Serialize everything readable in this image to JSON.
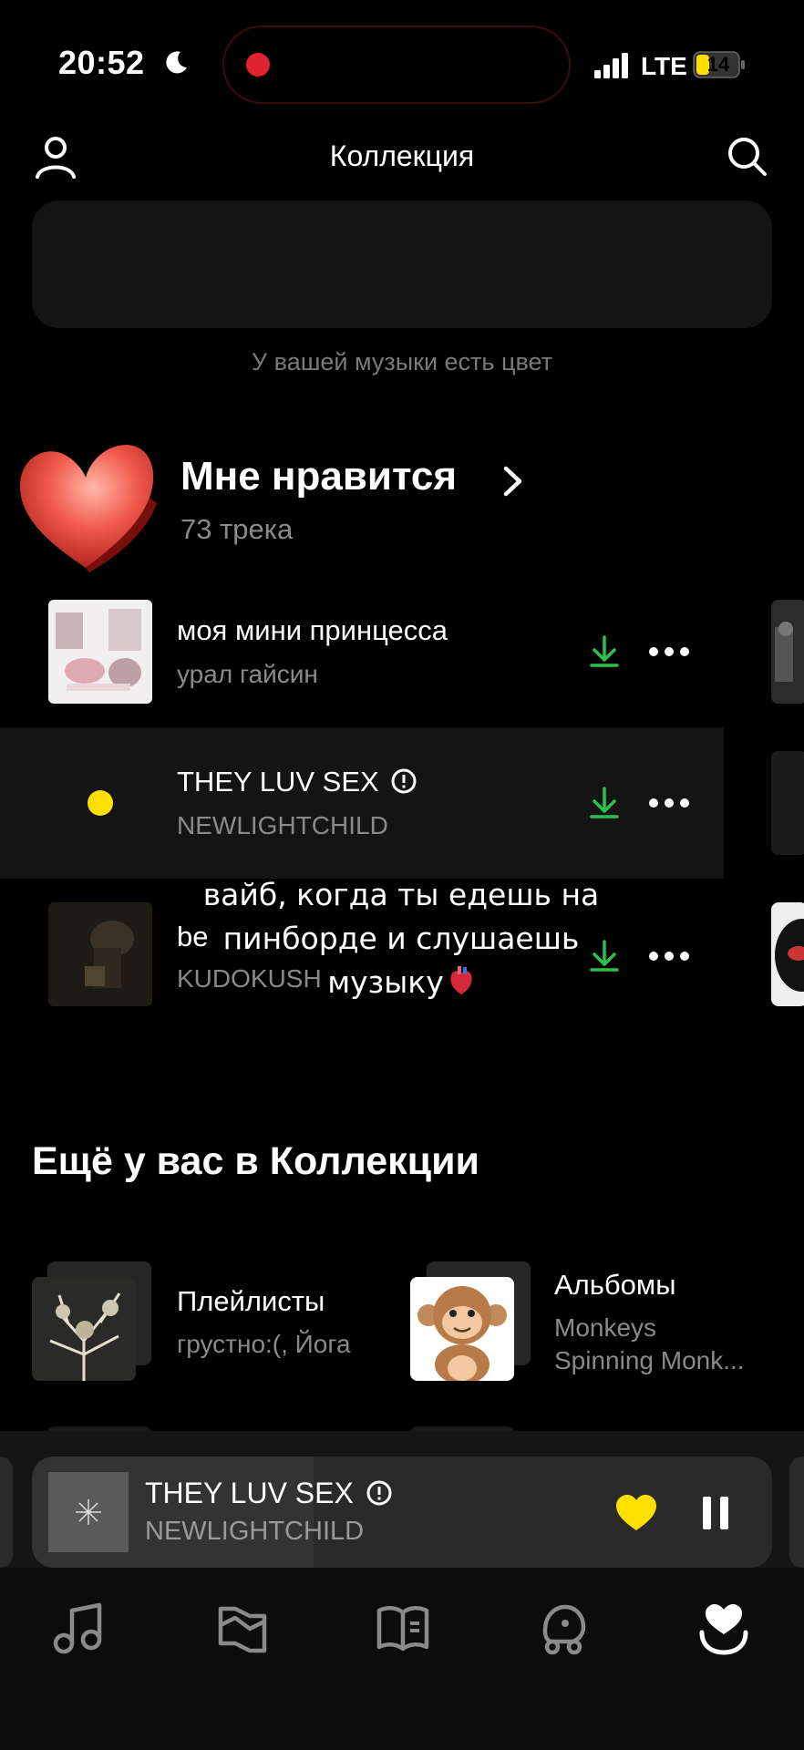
{
  "status_bar": {
    "time": "20:52",
    "network": "LTE",
    "battery": "14",
    "icons": [
      "moon-icon",
      "signal-icon",
      "battery-icon",
      "recording-dot"
    ]
  },
  "header": {
    "title": "Коллекция",
    "left_icon": "profile-icon",
    "right_icon": "search-icon"
  },
  "banner": {
    "caption": "У вашей музыки есть цвет"
  },
  "likes": {
    "title": "Мне нравится",
    "count": "73 трека"
  },
  "tracks": [
    {
      "title": "моя мини принцесса",
      "artist": "урал гайсин",
      "downloaded": true
    },
    {
      "title": "THEY LUV SEX",
      "artist": "NEWLIGHTCHILD",
      "explicit": true,
      "playing": true,
      "downloaded": true
    },
    {
      "title": "be",
      "artist": "KUDOKUSH",
      "downloaded": true
    }
  ],
  "overlay_caption": {
    "line1": "вайб, когда ты едешь на",
    "line2": "пинборде и слушаешь",
    "line3": "музыку"
  },
  "collection": {
    "title": "Ещё у вас в Коллекции",
    "items": [
      {
        "title": "Плейлисты",
        "subtitle": "грустно:(, Йога"
      },
      {
        "title": "Альбомы",
        "subtitle_line1": "Monkeys",
        "subtitle_line2": "Spinning Monk..."
      }
    ]
  },
  "player": {
    "title": "THEY LUV SEX",
    "artist": "NEWLIGHTCHILD",
    "explicit": true,
    "liked": true,
    "state": "playing",
    "progress_fraction": 0.38
  },
  "nav": {
    "items": [
      {
        "id": "music",
        "icon": "music-note-icon"
      },
      {
        "id": "podcasts",
        "icon": "map-icon"
      },
      {
        "id": "books",
        "icon": "book-icon"
      },
      {
        "id": "kids",
        "icon": "kids-icon"
      },
      {
        "id": "collection",
        "icon": "heart-collection-icon",
        "active": true
      }
    ]
  },
  "colors": {
    "accent_yellow": "#ffdf00",
    "download_green": "#2dc14b",
    "background": "#000000",
    "muted_text": "#8a8a8a"
  }
}
